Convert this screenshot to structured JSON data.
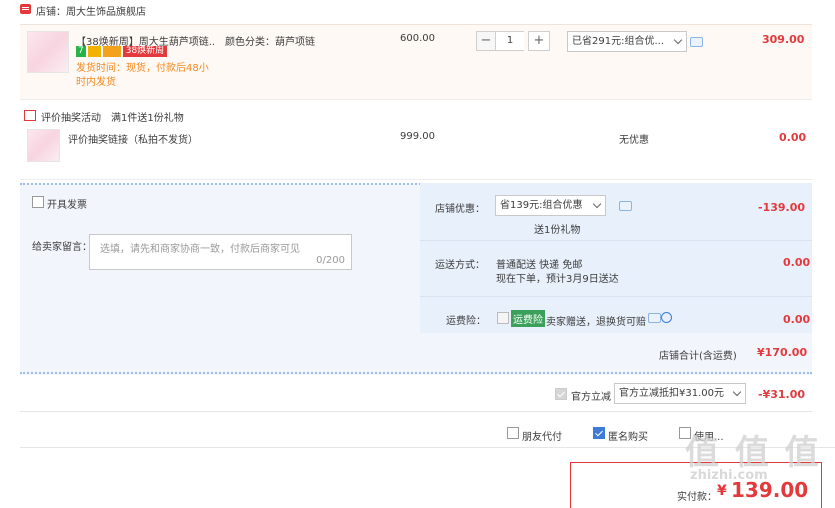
{
  "store": {
    "name": "店铺：周大生饰品旗舰店"
  },
  "item": {
    "title": "【38焕新周】周大生葫芦项链...",
    "promo_badge": "38焕新周",
    "badge_numbers": [
      "7"
    ],
    "shipping_time": "发货时间：现货，付款后48小时内发货",
    "sku_label": "颜色分类：葫芦项链",
    "unit_price": "600.00",
    "quantity": "1",
    "discount_option": "已省291元:组合优...",
    "subtotal": "309.00",
    "qty_minus": "−",
    "qty_plus": "+"
  },
  "gift": {
    "header_label": "评价抽奖活动",
    "header_rule": "满1件送1份礼物",
    "item_title": "评价抽奖链接（私拍不发货）",
    "unit_price": "999.00",
    "discount": "无优惠",
    "subtotal": "0.00"
  },
  "invoice": {
    "label": "开具发票"
  },
  "message": {
    "label": "给卖家留言：",
    "placeholder": "选填，请先和商家协商一致，付款后商家可见",
    "counter": "0/200"
  },
  "store_discount": {
    "label": "店铺优惠：",
    "selected": "省139元:组合优惠",
    "gift_note": "送1份礼物",
    "amount": "-139.00"
  },
  "delivery": {
    "label": "运送方式：",
    "line1": "普通配送 快递 免邮",
    "line2": "现在下单，预计3月9日送达",
    "amount": "0.00"
  },
  "insurance": {
    "label": "运费险：",
    "tag": "运费险",
    "desc": "卖家赠送，退换货可赔",
    "amount": "0.00"
  },
  "store_total": {
    "label": "店铺合计(含运费)",
    "amount": "¥170.00"
  },
  "official": {
    "label": "官方立减",
    "selected": "官方立减抵扣¥31.00元",
    "amount": "-¥31.00"
  },
  "options": {
    "friend_pay": "朋友代付",
    "anonymous": "匿名购买",
    "third": "使用..."
  },
  "payment": {
    "label": "实付款：",
    "currency": "¥",
    "amount": "139.00"
  },
  "watermark": {
    "text": "值 值 值",
    "domain": "zhizhi.com"
  },
  "colors": {
    "accent_red": "#e4393c",
    "pane_blue": "#e8f0fb"
  }
}
